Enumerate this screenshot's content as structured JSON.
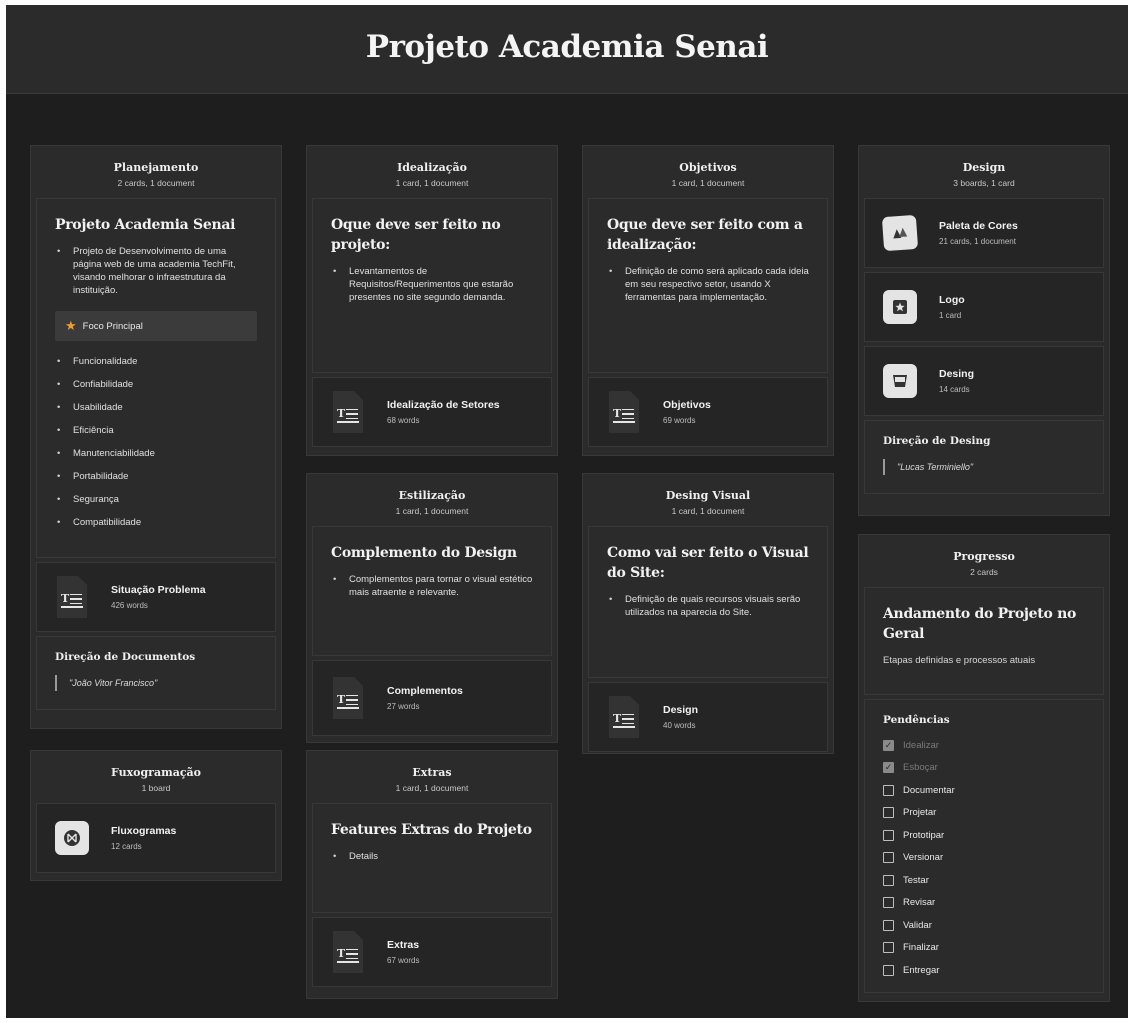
{
  "board_title": "Projeto Academia Senai",
  "planejamento": {
    "title": "Planejamento",
    "sub": "2 cards, 1 document",
    "note_title": "Projeto Academia Senai",
    "note_bullet": "Projeto de Desenvolvimento de uma página web de uma academia TechFit, visando melhorar o infraestrutura da instituição.",
    "focus": "Foco Principal",
    "qualities": [
      "Funcionalidade",
      "Confiabilidade",
      "Usabilidade",
      "Eficiência",
      "Manutenciabilidade",
      "Portabilidade",
      "Segurança",
      "Compatibilidade"
    ],
    "doc_title": "Situação Problema",
    "doc_words": "426 words",
    "credit_title": "Direção de Documentos",
    "credit_name": "\"João Vitor Francisco\""
  },
  "fuxogramacao": {
    "title": "Fuxogramação",
    "sub": "1 board",
    "board_title": "Fluxogramas",
    "board_sub": "12 cards"
  },
  "idealizacao": {
    "title": "Idealização",
    "sub": "1 card, 1 document",
    "note_title": "Oque deve ser feito no projeto:",
    "note_bullet": "Levantamentos de Requisitos/Requerimentos que estarão presentes no site segundo demanda.",
    "doc_title": "Idealização de Setores",
    "doc_words": "68 words"
  },
  "estilizacao": {
    "title": "Estilização",
    "sub": "1 card, 1 document",
    "note_title": "Complemento do Design",
    "note_bullet": "Complementos para tornar o visual estético mais atraente e relevante.",
    "doc_title": "Complementos",
    "doc_words": "27 words"
  },
  "extras": {
    "title": "Extras",
    "sub": "1 card, 1 document",
    "note_title": "Features Extras do Projeto",
    "note_bullet": "Details",
    "doc_title": "Extras",
    "doc_words": "67 words"
  },
  "objetivos": {
    "title": "Objetivos",
    "sub": "1 card, 1 document",
    "note_title": "Oque deve ser feito com a idealização:",
    "note_bullet": "Definição de como será aplicado cada ideia em seu respectivo setor, usando X ferramentas para implementação.",
    "doc_title": "Objetivos",
    "doc_words": "69 words"
  },
  "desing_visual": {
    "title": "Desing Visual",
    "sub": "1 card, 1 document",
    "note_title": "Como vai ser feito o Visual do Site:",
    "note_bullet": "Definição de quais recursos visuais serão utilizados na aparecia do Site.",
    "doc_title": "Design",
    "doc_words": "40 words"
  },
  "design": {
    "title": "Design",
    "sub": "3 boards, 1 card",
    "boards": [
      {
        "title": "Paleta de Cores",
        "sub": "21 cards, 1 document"
      },
      {
        "title": "Logo",
        "sub": "1 card"
      },
      {
        "title": "Desing",
        "sub": "14 cards"
      }
    ],
    "credit_title": "Direção de Desing",
    "credit_name": "\"Lucas Terminiello\""
  },
  "progresso": {
    "title": "Progresso",
    "sub": "2 cards",
    "note_title": "Andamento do Projeto no Geral",
    "note_desc": "Etapas definidas e processos atuais",
    "todo_title": "Pendências",
    "tasks": [
      {
        "label": "Idealizar",
        "done": true
      },
      {
        "label": "Esboçar",
        "done": true
      },
      {
        "label": "Documentar",
        "done": false
      },
      {
        "label": "Projetar",
        "done": false
      },
      {
        "label": "Prototipar",
        "done": false
      },
      {
        "label": "Versionar",
        "done": false
      },
      {
        "label": "Testar",
        "done": false
      },
      {
        "label": "Revisar",
        "done": false
      },
      {
        "label": "Validar",
        "done": false
      },
      {
        "label": "Finalizar",
        "done": false
      },
      {
        "label": "Entregar",
        "done": false
      }
    ]
  }
}
